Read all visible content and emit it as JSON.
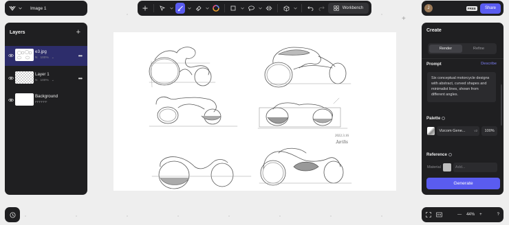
{
  "document": {
    "title": "Image 1"
  },
  "toolbar": {
    "workbench_label": "Workbench"
  },
  "account": {
    "avatar_initial": "J",
    "plan_badge": "FREE",
    "share_label": "Share"
  },
  "layers": {
    "heading": "Layers",
    "items": [
      {
        "name": "e3.jpg",
        "blend": "N",
        "opacity": "100%",
        "selected": true
      },
      {
        "name": "Layer 1",
        "blend": "N",
        "opacity": "100%",
        "selected": false
      },
      {
        "name": "Background",
        "color": "FFFFFF",
        "selected": false
      }
    ]
  },
  "canvas": {
    "sketch_annotation_date": "2022.3.16",
    "sketch_annotation_signature": "Jarilis"
  },
  "create": {
    "heading": "Create",
    "tabs": [
      "Render",
      "Refine"
    ],
    "active_tab": "Render",
    "prompt_label": "Prompt",
    "describe_label": "Describe",
    "prompt_text": "Six conceptual motorcycle designs with abstract, curved shapes and minimalist lines, shown from different angles.",
    "palette_label": "Palette",
    "palette_name": "Vizcom Gene...",
    "palette_version": "v2",
    "palette_strength": "100%",
    "reference_label": "Reference",
    "material_label": "Material",
    "add_placeholder": "Add...",
    "generate_label": "Generate"
  },
  "zoom": {
    "level": "44%",
    "help_label": "?"
  },
  "colors": {
    "accent": "#5a5cf0",
    "panel": "#1f1f21",
    "selected_row": "#2d2d6b",
    "link": "#7d7ff5"
  }
}
